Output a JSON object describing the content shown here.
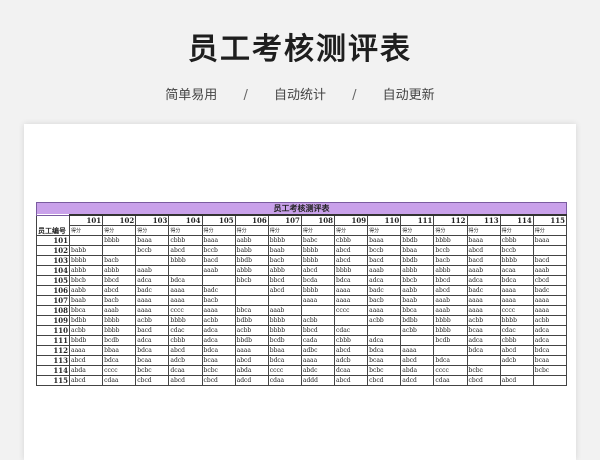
{
  "header": {
    "title": "员工考核测评表",
    "tags": [
      "简单易用",
      "自动统计",
      "自动更新"
    ],
    "separator": "/"
  },
  "table": {
    "title": "员工考核测评表",
    "corner": "员工编号",
    "columns": [
      "101",
      "102",
      "103",
      "104",
      "105",
      "106",
      "107",
      "108",
      "109",
      "110",
      "111",
      "112",
      "113",
      "114",
      "115"
    ],
    "sublabel": "得分",
    "rows": [
      {
        "id": "101",
        "cells": [
          "",
          "bbbb",
          "baaa",
          "cbbb",
          "baaa",
          "aabb",
          "bbbb",
          "babc",
          "cbbb",
          "baaa",
          "bbdb",
          "bbbb",
          "baaa",
          "cbbb",
          "baaa"
        ]
      },
      {
        "id": "102",
        "cells": [
          "babb",
          "",
          "bccb",
          "abcd",
          "bccb",
          "babb",
          "baab",
          "bbbb",
          "abcd",
          "bccb",
          "bbaa",
          "bccb",
          "abcd",
          "bccb",
          ""
        ]
      },
      {
        "id": "103",
        "cells": [
          "bbbb",
          "bacb",
          "",
          "bbbb",
          "bacd",
          "bbdb",
          "bacb",
          "bbbb",
          "abcd",
          "bacd",
          "bbdb",
          "bacb",
          "bacd",
          "bbbb",
          "bacd"
        ]
      },
      {
        "id": "104",
        "cells": [
          "abbb",
          "abbb",
          "aaab",
          "",
          "aaab",
          "abbb",
          "abbb",
          "abcd",
          "bbbb",
          "aaab",
          "abbb",
          "abbb",
          "aaab",
          "acaa",
          "aaab"
        ]
      },
      {
        "id": "105",
        "cells": [
          "bbcb",
          "bbcd",
          "adca",
          "bdca",
          "",
          "bbcb",
          "bbcd",
          "bcda",
          "bdca",
          "adca",
          "bbcb",
          "bbcd",
          "adca",
          "bdca",
          "cbcd"
        ]
      },
      {
        "id": "106",
        "cells": [
          "aabb",
          "abcd",
          "badc",
          "aaaa",
          "badc",
          "",
          "abcd",
          "bbbb",
          "aaaa",
          "badc",
          "aabb",
          "abcd",
          "badc",
          "aaaa",
          "badc"
        ]
      },
      {
        "id": "107",
        "cells": [
          "baab",
          "bacb",
          "aaaa",
          "aaaa",
          "bacb",
          "",
          "",
          "aaaa",
          "aaaa",
          "bacb",
          "baab",
          "aaab",
          "aaaa",
          "aaaa",
          "aaaa"
        ]
      },
      {
        "id": "108",
        "cells": [
          "bbca",
          "aaab",
          "aaaa",
          "cccc",
          "aaaa",
          "bbca",
          "aaab",
          "",
          "cccc",
          "aaaa",
          "bbca",
          "aaab",
          "aaaa",
          "cccc",
          "aaaa"
        ]
      },
      {
        "id": "109",
        "cells": [
          "bdbb",
          "bbbb",
          "acbb",
          "bbbb",
          "acbb",
          "bdbb",
          "bbbb",
          "acbb",
          "",
          "acbb",
          "bdbb",
          "bbbb",
          "acbb",
          "bbbb",
          "acbb"
        ]
      },
      {
        "id": "110",
        "cells": [
          "acbb",
          "bbbb",
          "bacd",
          "cdac",
          "adca",
          "acbb",
          "bbbb",
          "bbcd",
          "cdac",
          "",
          "acbb",
          "bbbb",
          "bcaa",
          "cdac",
          "adca"
        ]
      },
      {
        "id": "111",
        "cells": [
          "bbdb",
          "bcdb",
          "adca",
          "cbbb",
          "adca",
          "bbdb",
          "bcdb",
          "cada",
          "cbbb",
          "adca",
          "",
          "bcdb",
          "adca",
          "cbbb",
          "adca"
        ]
      },
      {
        "id": "112",
        "cells": [
          "aaaa",
          "bbaa",
          "bdca",
          "abcd",
          "bdca",
          "aaaa",
          "bbaa",
          "adbc",
          "abcd",
          "bdca",
          "aaaa",
          "",
          "bdca",
          "abcd",
          "bdca"
        ]
      },
      {
        "id": "113",
        "cells": [
          "abcd",
          "bdca",
          "bcaa",
          "adcb",
          "bcaa",
          "abcd",
          "bdca",
          "aaaa",
          "adcb",
          "bcaa",
          "abcd",
          "bdca",
          "",
          "adcb",
          "bcaa"
        ]
      },
      {
        "id": "114",
        "cells": [
          "abda",
          "cccc",
          "bcbc",
          "dcaa",
          "bcbc",
          "abda",
          "cccc",
          "abdc",
          "dcaa",
          "bcbc",
          "abda",
          "cccc",
          "bcbc",
          "",
          "bcbc"
        ]
      },
      {
        "id": "115",
        "cells": [
          "abcd",
          "cdaa",
          "cbcd",
          "abcd",
          "cbcd",
          "adcd",
          "cdaa",
          "addd",
          "abcd",
          "cbcd",
          "adcd",
          "cdaa",
          "cbcd",
          "abcd",
          ""
        ]
      }
    ]
  }
}
